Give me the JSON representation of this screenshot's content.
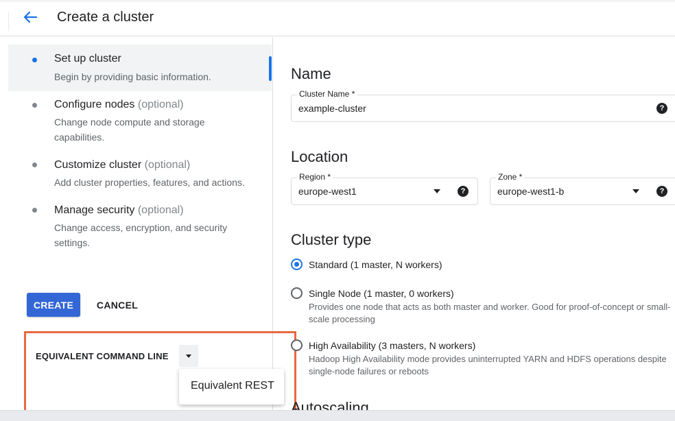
{
  "header": {
    "title": "Create a cluster",
    "back_icon": "arrow-back-icon"
  },
  "sidebar": {
    "steps": [
      {
        "title": "Set up cluster",
        "optional": "",
        "desc": "Begin by providing basic information."
      },
      {
        "title": "Configure nodes",
        "optional": "(optional)",
        "desc": "Change node compute and storage capabilities."
      },
      {
        "title": "Customize cluster",
        "optional": "(optional)",
        "desc": "Add cluster properties, features, and actions."
      },
      {
        "title": "Manage security",
        "optional": "(optional)",
        "desc": "Change access, encryption, and security settings."
      }
    ],
    "create_label": "CREATE",
    "cancel_label": "CANCEL",
    "equivalent": {
      "label": "EQUIVALENT COMMAND LINE",
      "menu_item": "Equivalent REST"
    }
  },
  "main": {
    "name_section": {
      "heading": "Name",
      "cluster_name_label": "Cluster Name *",
      "cluster_name_value": "example-cluster"
    },
    "location_section": {
      "heading": "Location",
      "region_label": "Region *",
      "region_value": "europe-west1",
      "zone_label": "Zone *",
      "zone_value": "europe-west1-b"
    },
    "cluster_type_section": {
      "heading": "Cluster type",
      "options": [
        {
          "label": "Standard (1 master, N workers)",
          "desc": "",
          "checked": true
        },
        {
          "label": "Single Node (1 master, 0 workers)",
          "desc": "Provides one node that acts as both master and worker. Good for proof-of-concept or small-scale processing",
          "checked": false
        },
        {
          "label": "High Availability (3 masters, N workers)",
          "desc": "Hadoop High Availability mode provides uninterrupted YARN and HDFS operations despite single-node failures or reboots",
          "checked": false
        }
      ]
    },
    "autoscaling_heading": "Autoscaling"
  },
  "colors": {
    "accent": "#1a73e8",
    "primary_button": "#3367d6",
    "highlight": "#e8693f"
  }
}
